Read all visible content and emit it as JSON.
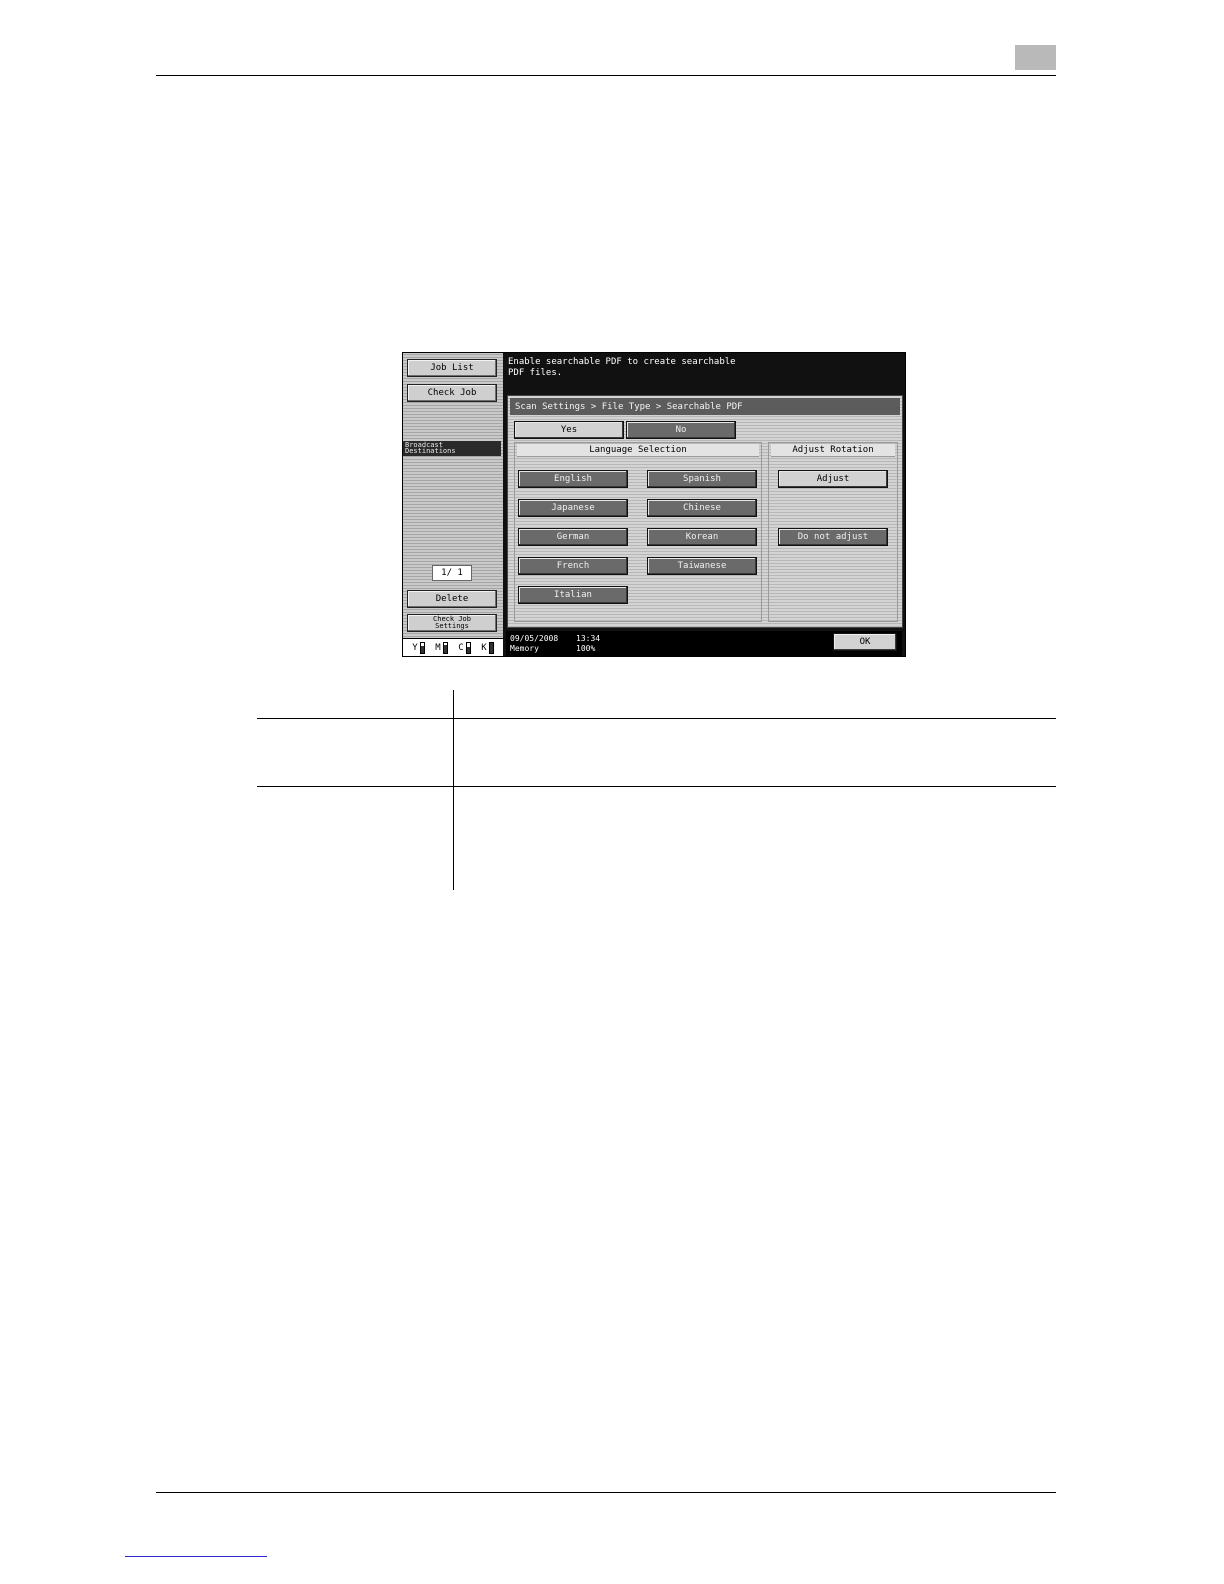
{
  "panel": {
    "sidebar": {
      "job_list": "Job List",
      "check_job": "Check Job",
      "broadcast_line1": "Broadcast",
      "broadcast_line2": "Destinations",
      "page_count": "1/  1",
      "delete": "Delete",
      "check_job_settings_line1": "Check Job",
      "check_job_settings_line2": "Settings",
      "toner": [
        {
          "label": "Y",
          "level": 0.7
        },
        {
          "label": "M",
          "level": 0.8
        },
        {
          "label": "C",
          "level": 0.6
        },
        {
          "label": "K",
          "level": 1.0
        }
      ]
    },
    "message_line1": "Enable searchable PDF to create searchable",
    "message_line2": "PDF files.",
    "breadcrumb": "Scan Settings > File Type > Searchable PDF",
    "yes": "Yes",
    "no": "No",
    "language_selection": "Language Selection",
    "languages": {
      "english": "English",
      "spanish": "Spanish",
      "japanese": "Japanese",
      "chinese": "Chinese",
      "german": "German",
      "korean": "Korean",
      "french": "French",
      "taiwanese": "Taiwanese",
      "italian": "Italian"
    },
    "adjust_rotation": "Adjust Rotation",
    "adjust": "Adjust",
    "do_not_adjust": "Do not adjust",
    "status": {
      "date": "09/05/2008",
      "time": "13:34",
      "memory_label": "Memory",
      "memory_value": "100%"
    },
    "ok": "OK"
  }
}
